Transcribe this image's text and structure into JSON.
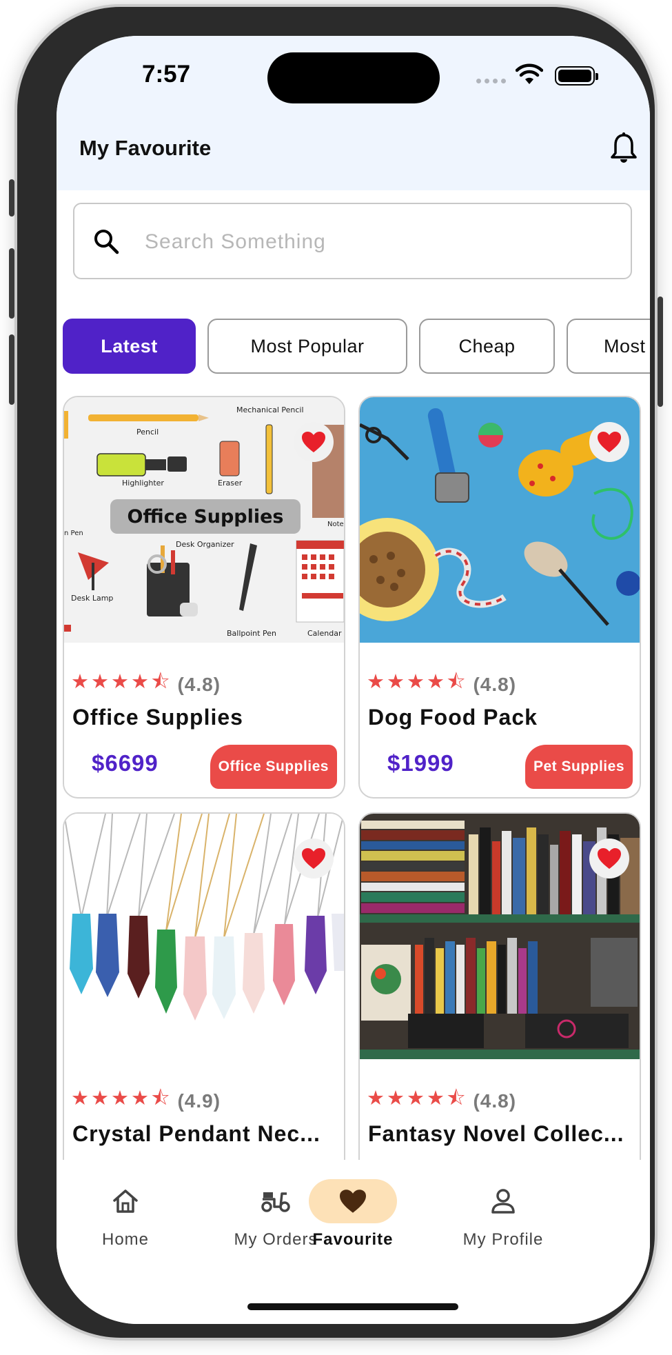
{
  "status_bar": {
    "time": "7:57"
  },
  "app_bar": {
    "title": "My Favourite",
    "bell_icon": "bell-icon"
  },
  "search": {
    "placeholder": "Search Something",
    "value": ""
  },
  "filters": [
    {
      "label": "Latest",
      "active": true
    },
    {
      "label": "Most Popular",
      "active": false
    },
    {
      "label": "Cheap",
      "active": false
    },
    {
      "label": "Most",
      "active": false
    }
  ],
  "products": [
    {
      "name": "Office Supplies",
      "rating_stars": 4.5,
      "rating_text": "(4.8)",
      "price": "$6699",
      "category": "Office Supplies",
      "favourite": true,
      "image_labels": {
        "banner": "Office Supplies",
        "pencil": "Pencil",
        "mech": "Mechanical Pencil",
        "highlighter": "Highlighter",
        "eraser": "Eraser",
        "pen": "n Pen",
        "organizer": "Desk Organizer",
        "lamp": "Desk Lamp",
        "ballpoint": "Ballpoint Pen",
        "calendar": "Calendar",
        "note": "Notel"
      }
    },
    {
      "name": "Dog Food Pack",
      "rating_stars": 4.5,
      "rating_text": "(4.8)",
      "price": "$1999",
      "category": "Pet Supplies",
      "favourite": true
    },
    {
      "name": "Crystal Pendant Nec...",
      "rating_stars": 4.5,
      "rating_text": "(4.9)",
      "favourite": true
    },
    {
      "name": "Fantasy Novel Collec...",
      "rating_stars": 4.5,
      "rating_text": "(4.8)",
      "favourite": true
    }
  ],
  "bottom_nav": [
    {
      "label": "Home",
      "icon": "home-icon",
      "active": false
    },
    {
      "label": "My Orders",
      "icon": "scooter-icon",
      "active": false
    },
    {
      "label": "Favourite",
      "icon": "heart-icon",
      "active": true
    },
    {
      "label": "My Profile",
      "icon": "person-icon",
      "active": false
    }
  ],
  "colors": {
    "primary": "#5022c8",
    "accent": "#ea4b48",
    "nav_active_bg": "#fde1b7",
    "appbar_bg": "#eff5fe"
  }
}
